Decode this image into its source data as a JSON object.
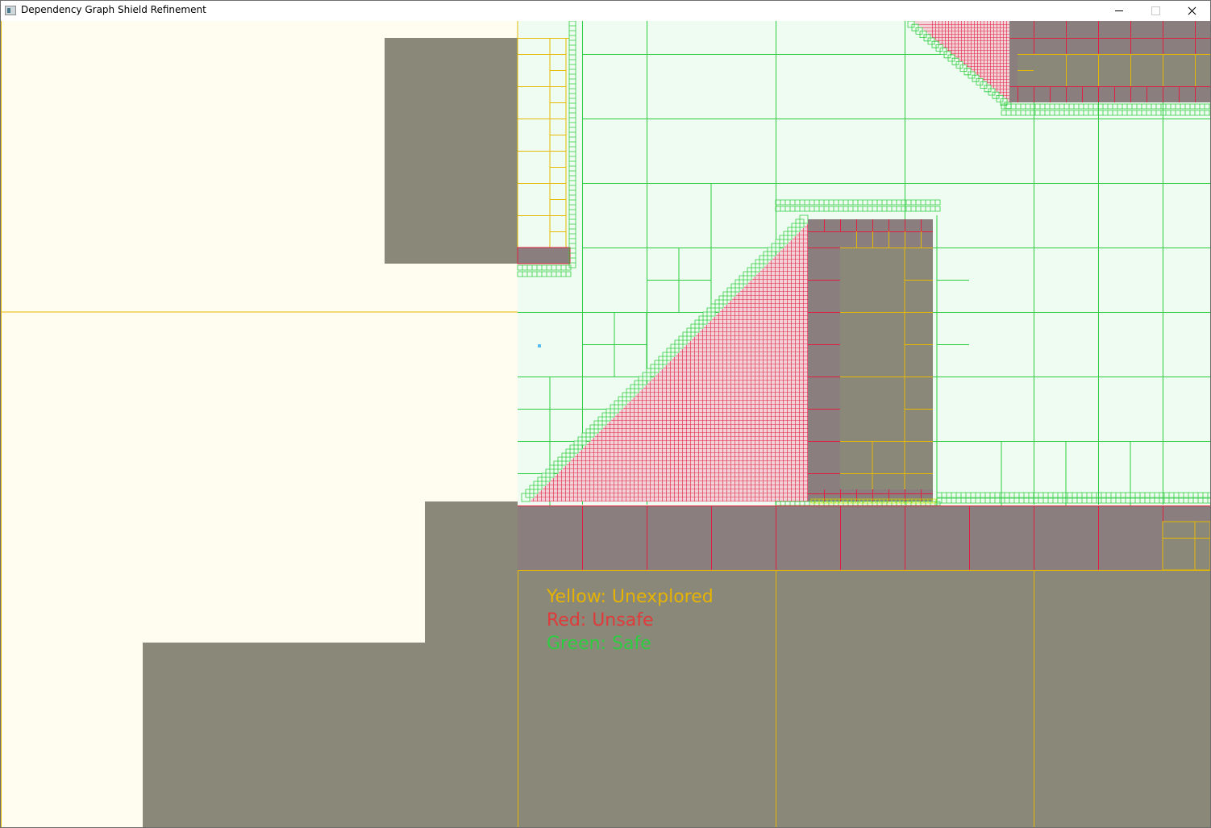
{
  "window": {
    "title": "Dependency Graph Shield Refinement"
  },
  "legend": {
    "unexplored": "Yellow: Unexplored",
    "unsafe": "Red: Unsafe",
    "safe": "Green: Safe"
  },
  "colors": {
    "background": "#fffdf0",
    "obstacle": "#8a8878",
    "unsafe_fill": "#8b7e7e",
    "safe_fill": "#effcf1",
    "unexplored_line": "#e6b800",
    "unsafe_line": "#e02040",
    "safe_line": "#2ecc40",
    "agent_marker": "#5bbcf0",
    "legend_yellow": "#e6b300",
    "legend_red": "#e03a3a",
    "legend_green": "#2ecc40"
  }
}
